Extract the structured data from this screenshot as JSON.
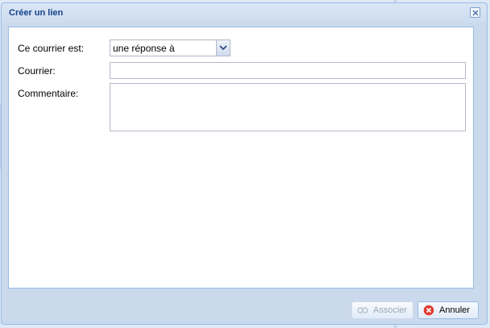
{
  "window": {
    "title": "Créer un lien"
  },
  "form": {
    "type_label": "Ce courrier est:",
    "type_value": "une réponse à",
    "courrier_label": "Courrier:",
    "courrier_value": "",
    "commentaire_label": "Commentaire:",
    "commentaire_value": ""
  },
  "footer": {
    "associate_label": "Associer",
    "cancel_label": "Annuler"
  },
  "icons": {
    "close": "close-icon",
    "dropdown": "chevron-down-icon",
    "associate": "link-icon",
    "cancel": "cancel-icon"
  },
  "colors": {
    "title_text": "#15428b",
    "cancel_icon": "#e03c31"
  }
}
